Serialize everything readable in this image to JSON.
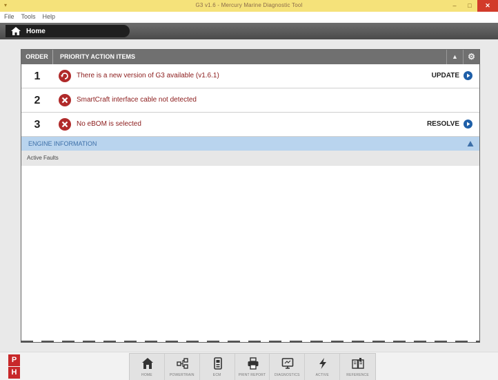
{
  "window": {
    "title": "G3 v1.6 - Mercury Marine Diagnostic Tool",
    "minimize": "–",
    "maximize": "□",
    "close": "✕"
  },
  "menu": [
    "File",
    "Tools",
    "Help"
  ],
  "breadcrumb": {
    "label": "Home"
  },
  "priority_panel": {
    "order_header": "ORDER",
    "title": "PRIORITY ACTION ITEMS",
    "collapse": "▲",
    "settings": "⚙",
    "items": [
      {
        "order": "1",
        "icon": "update-icon",
        "message": "There is a new version of G3 available (v1.6.1)",
        "action": "UPDATE"
      },
      {
        "order": "2",
        "icon": "error-icon",
        "message": "SmartCraft interface cable not detected",
        "action": ""
      },
      {
        "order": "3",
        "icon": "error-icon",
        "message": "No eBOM is selected",
        "action": "RESOLVE"
      }
    ]
  },
  "engine_panel": {
    "title": "ENGINE INFORMATION",
    "active_faults_label": "Active Faults"
  },
  "badges": {
    "p": "P",
    "h": "H"
  },
  "dock": [
    {
      "icon": "home-icon",
      "label": "HOME"
    },
    {
      "icon": "powertrain-icon",
      "label": "POWERTRAIN"
    },
    {
      "icon": "ecm-icon",
      "label": "ECM"
    },
    {
      "icon": "printer-icon",
      "label": "PRINT REPORT"
    },
    {
      "icon": "monitor-icon",
      "label": "DIAGNOSTICS"
    },
    {
      "icon": "lightning-icon",
      "label": "ACTIVE"
    },
    {
      "icon": "manual-icon",
      "label": "REFERENCE"
    }
  ],
  "colors": {
    "titlebar": "#f5e27a",
    "accent_red": "#c8282a",
    "message_red": "#8b1a1a",
    "engine_header": "#b9d4ee",
    "action_blue": "#1e5fa8"
  }
}
